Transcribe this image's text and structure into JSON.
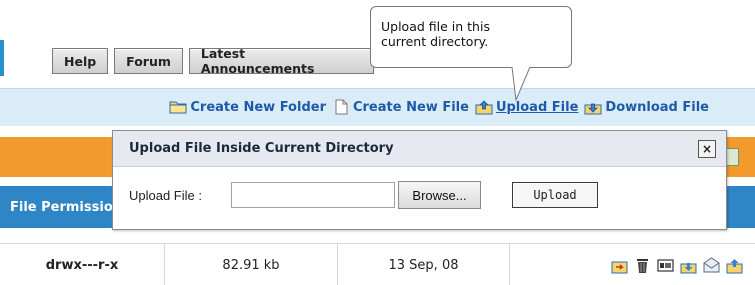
{
  "tabs": [
    {
      "label": "Help"
    },
    {
      "label": "Forum"
    },
    {
      "label": "Latest Announcements"
    }
  ],
  "action_bar": {
    "create_folder": "Create New Folder",
    "create_file": "Create New File",
    "upload_file": "Upload File",
    "download_file": "Download File"
  },
  "tooltip": {
    "line1": "Upload file in this",
    "line2": "current directory."
  },
  "modal": {
    "title": "Upload File Inside Current Directory",
    "close": "×",
    "field_label": "Upload File :",
    "file_value": "",
    "browse": "Browse...",
    "upload": "Upload"
  },
  "table": {
    "headers": [
      "File Permissions"
    ],
    "rows": [
      {
        "permissions": "drwx---r-x",
        "size": "82.91 kb",
        "date": "13 Sep, 08"
      }
    ]
  },
  "colors": {
    "accent_blue": "#2e86c7",
    "action_bar": "#d9ecf7",
    "orange": "#f29a2b",
    "link": "#1e5aa8"
  }
}
